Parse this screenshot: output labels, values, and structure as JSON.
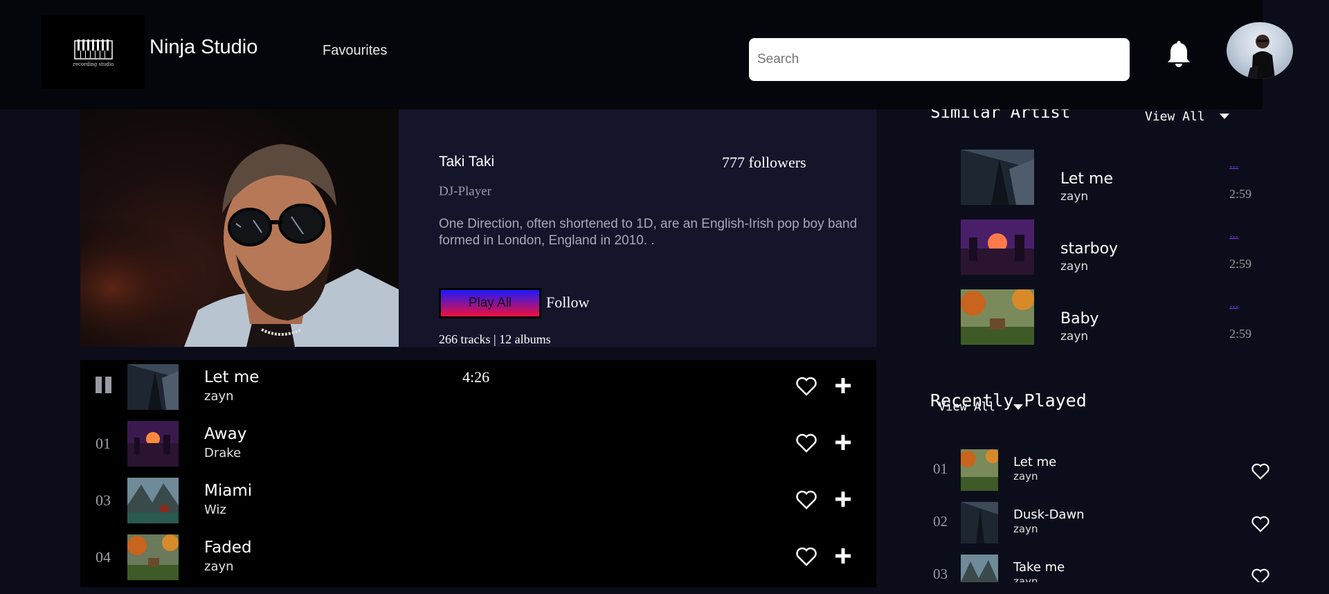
{
  "header": {
    "logo_caption": "recording studio",
    "brand": "Ninja Studio",
    "nav_favourites": "Favourites",
    "search_placeholder": "Search"
  },
  "artist": {
    "name": "Taki Taki",
    "followers": "777 followers",
    "role": "DJ-Player",
    "bio": "One Direction, often shortened to 1D, are an English-Irish pop boy band formed in London, England in 2010. .",
    "play_all": "Play All",
    "follow": "Follow",
    "stats": "266 tracks | 12 albums"
  },
  "tracks": [
    {
      "num": "",
      "title": "Let me",
      "artist": "zayn",
      "duration": "4:26",
      "playing": true
    },
    {
      "num": "01",
      "title": "Away",
      "artist": "Drake",
      "duration": ""
    },
    {
      "num": "03",
      "title": "Miami",
      "artist": "Wiz",
      "duration": ""
    },
    {
      "num": "04",
      "title": "Faded",
      "artist": "zayn",
      "duration": ""
    }
  ],
  "similar": {
    "heading": "Similar Artist",
    "view_all": "View All",
    "items": [
      {
        "title": "Let me",
        "artist": "zayn",
        "more": "...",
        "duration": "2:59"
      },
      {
        "title": "starboy",
        "artist": "zayn",
        "more": "...",
        "duration": "2:59"
      },
      {
        "title": "Baby",
        "artist": "zayn",
        "more": "...",
        "duration": "2:59"
      }
    ]
  },
  "recent": {
    "heading": "Recently Played",
    "view_all": "View All",
    "items": [
      {
        "num": "01",
        "title": "Let me",
        "artist": "zayn"
      },
      {
        "num": "02",
        "title": "Dusk-Dawn",
        "artist": "zayn"
      },
      {
        "num": "03",
        "title": "Take me",
        "artist": "zayn"
      }
    ]
  },
  "colors": {
    "page_bg": "#0c0d1a",
    "topbar_bg": "#05060b",
    "hero_info_bg": "#14152b",
    "play_gradient_top": "#1d18ff",
    "play_gradient_bottom": "#f0103a",
    "more_link": "#7a3cff"
  },
  "icons": [
    "notification-bell-icon",
    "pause-icon",
    "heart-icon",
    "plus-icon",
    "caret-down-icon"
  ]
}
